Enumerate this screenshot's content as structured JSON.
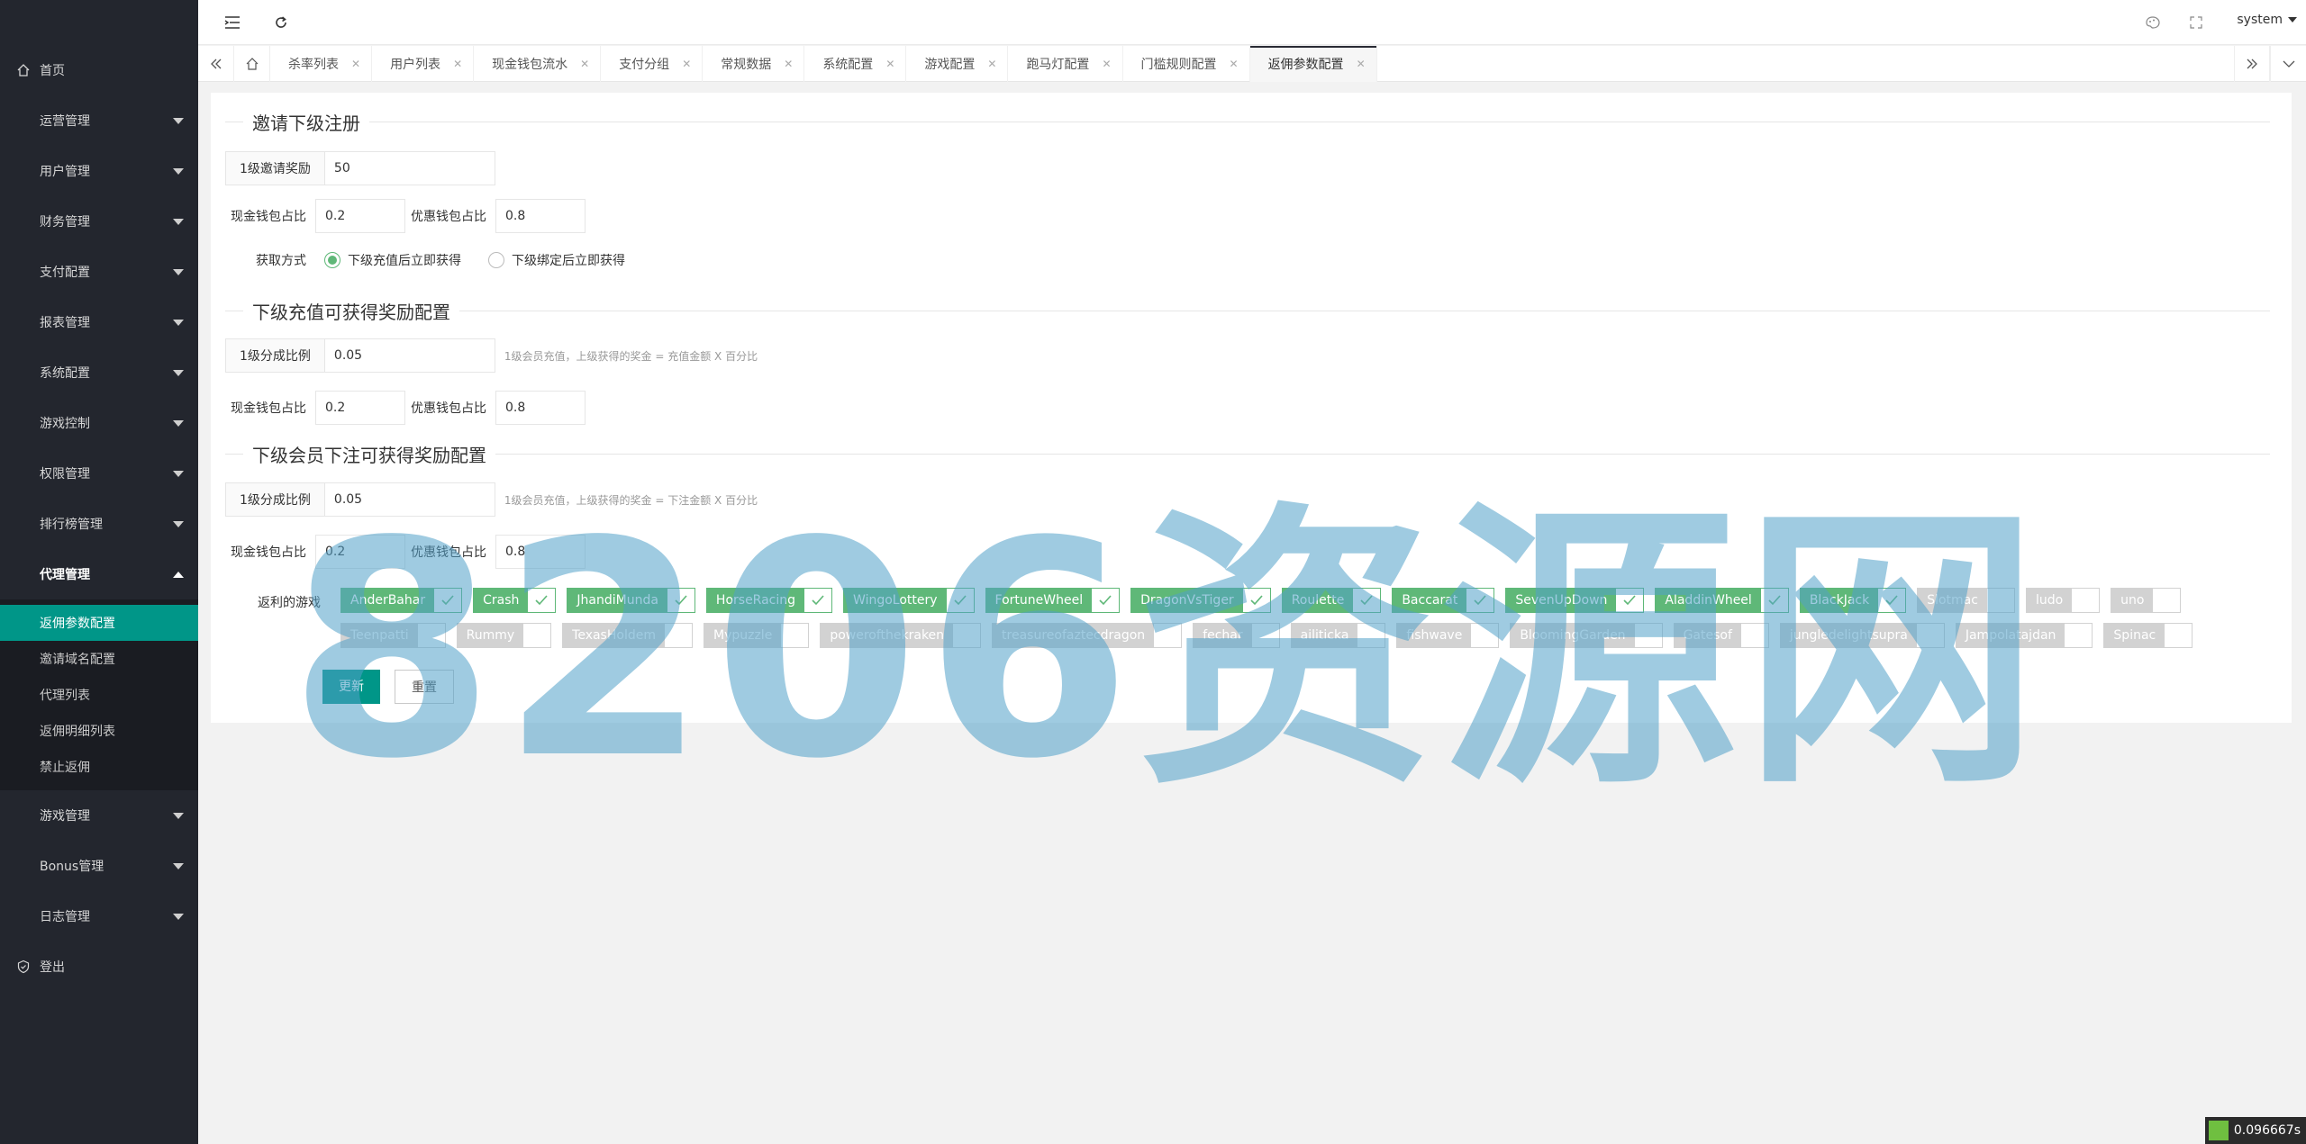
{
  "sidebar": {
    "home": "首页",
    "menus": [
      {
        "label": "运营管理"
      },
      {
        "label": "用户管理"
      },
      {
        "label": "财务管理"
      },
      {
        "label": "支付配置"
      },
      {
        "label": "报表管理"
      },
      {
        "label": "系统配置"
      },
      {
        "label": "游戏控制"
      },
      {
        "label": "权限管理"
      },
      {
        "label": "排行榜管理"
      },
      {
        "label": "代理管理"
      }
    ],
    "submenu": [
      {
        "label": "返佣参数配置",
        "active": true
      },
      {
        "label": "邀请域名配置"
      },
      {
        "label": "代理列表"
      },
      {
        "label": "返佣明细列表"
      },
      {
        "label": "禁止返佣"
      }
    ],
    "menus_after": [
      {
        "label": "游戏管理"
      },
      {
        "label": "Bonus管理"
      },
      {
        "label": "日志管理"
      }
    ],
    "logout": "登出"
  },
  "header": {
    "user": "system"
  },
  "tabs": [
    {
      "label": "杀率列表"
    },
    {
      "label": "用户列表"
    },
    {
      "label": "现金钱包流水"
    },
    {
      "label": "支付分组"
    },
    {
      "label": "常规数据"
    },
    {
      "label": "系统配置"
    },
    {
      "label": "游戏配置"
    },
    {
      "label": "跑马灯配置"
    },
    {
      "label": "门槛规则配置"
    },
    {
      "label": "返佣参数配置",
      "active": true
    }
  ],
  "form": {
    "section1": {
      "title": "邀请下级注册",
      "reward_label": "1级邀请奖励",
      "reward_value": "50",
      "cash_label": "现金钱包占比",
      "cash_value": "0.2",
      "bonus_label": "优惠钱包占比",
      "bonus_value": "0.8",
      "method_label": "获取方式",
      "method_option1": "下级充值后立即获得",
      "method_option2": "下级绑定后立即获得",
      "method_selected": 1
    },
    "section2": {
      "title": "下级充值可获得奖励配置",
      "ratio_label": "1级分成比例",
      "ratio_value": "0.05",
      "hint": "1级会员充值，上级获得的奖金 = 充值金额 X 百分比",
      "cash_label": "现金钱包占比",
      "cash_value": "0.2",
      "bonus_label": "优惠钱包占比",
      "bonus_value": "0.8"
    },
    "section3": {
      "title": "下级会员下注可获得奖励配置",
      "ratio_label": "1级分成比例",
      "ratio_value": "0.05",
      "hint": "1级会员充值，上级获得的奖金 = 下注金额 X 百分比",
      "cash_label": "现金钱包占比",
      "cash_value": "0.2",
      "bonus_label": "优惠钱包占比",
      "bonus_value": "0.8",
      "games_label": "返利的游戏"
    },
    "games": [
      {
        "name": "AnderBahar",
        "on": true
      },
      {
        "name": "Crash",
        "on": true
      },
      {
        "name": "JhandiMunda",
        "on": true
      },
      {
        "name": "HorseRacing",
        "on": true
      },
      {
        "name": "WingoLottery",
        "on": true
      },
      {
        "name": "FortuneWheel",
        "on": true
      },
      {
        "name": "DragonVsTiger",
        "on": true
      },
      {
        "name": "Roulette",
        "on": true
      },
      {
        "name": "Baccarat",
        "on": true
      },
      {
        "name": "SevenUpDown",
        "on": true
      },
      {
        "name": "AladdinWheel",
        "on": true
      },
      {
        "name": "BlackJack",
        "on": true
      },
      {
        "name": "Slotmac",
        "on": false
      },
      {
        "name": "ludo",
        "on": false
      },
      {
        "name": "uno",
        "on": false
      },
      {
        "name": "Teenpatti",
        "on": false
      },
      {
        "name": "Rummy",
        "on": false
      },
      {
        "name": "TexasHoldem",
        "on": false
      },
      {
        "name": "Mypuzzle",
        "on": false
      },
      {
        "name": "powerofthekraken",
        "on": false
      },
      {
        "name": "treasureofaztecdragon",
        "on": false
      },
      {
        "name": "fechar",
        "on": false
      },
      {
        "name": "ailiticka",
        "on": false
      },
      {
        "name": "fishwave",
        "on": false
      },
      {
        "name": "BloomingGarden",
        "on": false
      },
      {
        "name": "Gatesof",
        "on": false
      },
      {
        "name": "jungledelightsupra",
        "on": false
      },
      {
        "name": "Jampolatajdan",
        "on": false
      },
      {
        "name": "Spinac",
        "on": false
      }
    ],
    "submit": "更新",
    "reset": "重置"
  },
  "watermark": "8206资源网",
  "timer": "0.096667s",
  "colors": {
    "accent": "#009688",
    "checked": "#5FB878",
    "sidebar": "#23262e"
  }
}
